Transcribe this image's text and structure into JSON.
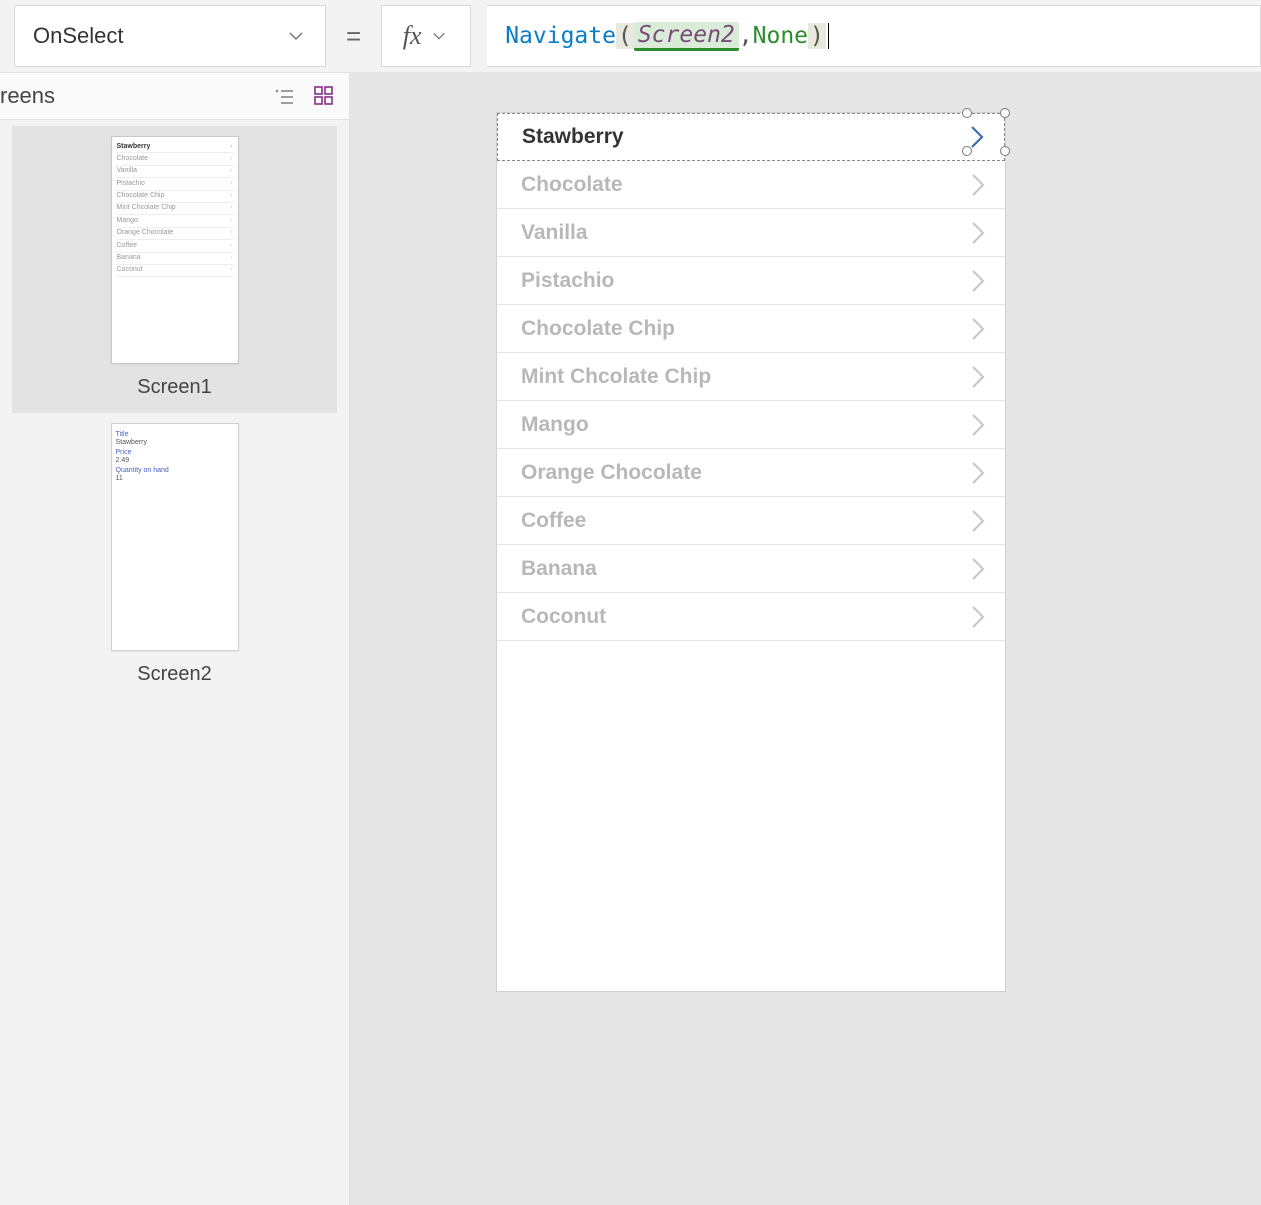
{
  "property_selector": {
    "value": "OnSelect"
  },
  "equals": "=",
  "fx_label": "fx",
  "formula": {
    "fn": "Navigate",
    "open": "(",
    "arg": "Screen2",
    "comma": ",",
    "none": "None",
    "close": ")"
  },
  "left_panel": {
    "title": "reens",
    "screens": [
      {
        "name": "Screen1",
        "selected": true
      },
      {
        "name": "Screen2",
        "selected": false
      }
    ],
    "screen2_preview": {
      "title_label": "Title",
      "title_value": "Stawberry",
      "price_label": "Price",
      "price_value": "2.49",
      "qty_label": "Quantity on hand",
      "qty_value": "11"
    }
  },
  "gallery": {
    "items": [
      {
        "label": "Stawberry",
        "selected": true
      },
      {
        "label": "Chocolate"
      },
      {
        "label": "Vanilla"
      },
      {
        "label": "Pistachio"
      },
      {
        "label": "Chocolate Chip"
      },
      {
        "label": "Mint Chcolate Chip"
      },
      {
        "label": "Mango"
      },
      {
        "label": "Orange Chocolate"
      },
      {
        "label": "Coffee"
      },
      {
        "label": "Banana"
      },
      {
        "label": "Coconut"
      }
    ]
  }
}
